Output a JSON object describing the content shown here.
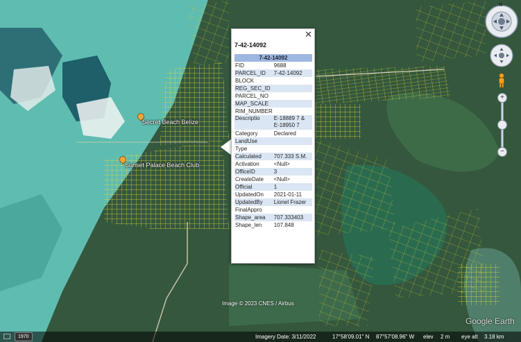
{
  "map": {
    "places": [
      {
        "name": "Secret Beach Belize"
      },
      {
        "name": "Sunset Palace Beach Club"
      }
    ],
    "attribution": "Image © 2023 CNES / Airbus",
    "logo": "Google Earth"
  },
  "popup": {
    "title": "7-42-14092",
    "header": "7-42-14092",
    "close": "✕",
    "rows": [
      {
        "k": "FID",
        "v": "9688"
      },
      {
        "k": "PARCEL_ID",
        "v": "7-42-14092"
      },
      {
        "k": "BLOCK",
        "v": ""
      },
      {
        "k": "REG_SEC_ID",
        "v": ""
      },
      {
        "k": "PARCEL_NO",
        "v": ""
      },
      {
        "k": "MAP_SCALE",
        "v": ""
      },
      {
        "k": "RIM_NUMBER",
        "v": ""
      },
      {
        "k": "Descriptio",
        "v": "E-18889 7 & E-18950 7"
      },
      {
        "k": "Category",
        "v": "Declared"
      },
      {
        "k": "LandUse",
        "v": ""
      },
      {
        "k": "Type",
        "v": ""
      },
      {
        "k": "Calculated",
        "v": "707.333 S.M."
      },
      {
        "k": "Activation",
        "v": "<Null>"
      },
      {
        "k": "OfficeID",
        "v": "3"
      },
      {
        "k": "CreateDate",
        "v": "<Null>"
      },
      {
        "k": "Official",
        "v": "1"
      },
      {
        "k": "UpdatedOn",
        "v": "2021-01-11"
      },
      {
        "k": "UpdatedBy",
        "v": "Lionel Frazer"
      },
      {
        "k": "FinalAppro",
        "v": ""
      },
      {
        "k": "Shape_area",
        "v": "707.333403"
      },
      {
        "k": "Shape_len",
        "v": "107.848"
      }
    ]
  },
  "controls": {
    "compass_label": "N",
    "zoom_in": "+",
    "zoom_out": "−"
  },
  "status": {
    "year": "1970",
    "imagery_date": "Imagery Date: 3/11/2022",
    "lat": "17°58'09.01\" N",
    "lon": "87°57'08.96\" W",
    "elev_label": "elev",
    "elev": "2 m",
    "eye_label": "eye alt",
    "eye": "3.18 km"
  },
  "colors": {
    "parcel_lines": "#e8e03a",
    "sea": "#5fbcb0",
    "popup_header": "#9db8e0",
    "popup_alt_row": "#dbe6f4"
  }
}
